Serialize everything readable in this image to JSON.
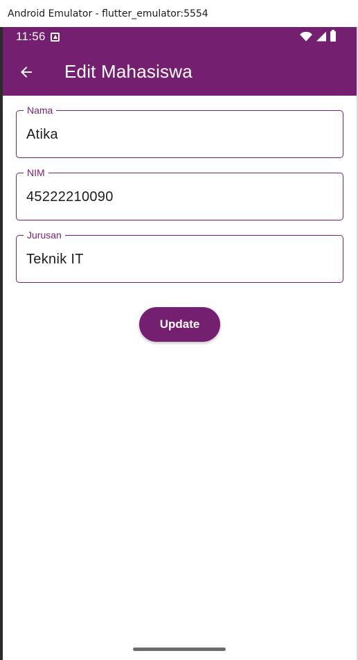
{
  "window": {
    "title": "Android Emulator - flutter_emulator:5554"
  },
  "status_bar": {
    "time": "11:56",
    "bg_color": "#741f6f"
  },
  "app_bar": {
    "title": "Edit Mahasiswa",
    "back_icon": "arrow-left-icon"
  },
  "form": {
    "fields": [
      {
        "label": "Nama",
        "value": "Atika"
      },
      {
        "label": "NIM",
        "value": "45222210090"
      },
      {
        "label": "Jurusan",
        "value": "Teknik IT"
      }
    ],
    "update_label": "Update"
  },
  "theme": {
    "primary": "#741f6f",
    "background": "#ffffff"
  }
}
